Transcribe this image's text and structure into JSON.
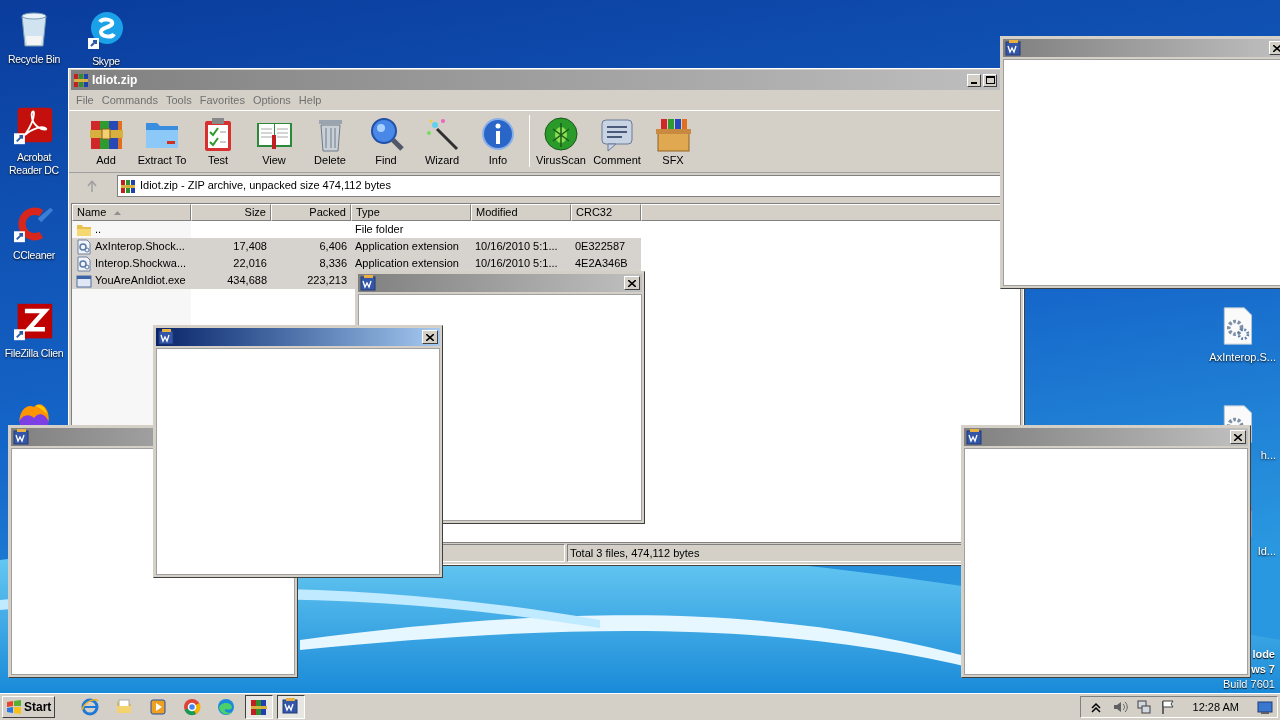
{
  "desktop_icons": [
    {
      "label": "Recycle Bin",
      "kind": "recycle-bin"
    },
    {
      "label": "Skype",
      "kind": "chat"
    },
    {
      "label": "Acrobat Reader DC",
      "kind": "acrobat"
    },
    {
      "label": "CCleaner",
      "kind": "ccleaner"
    },
    {
      "label": "FileZilla Clien",
      "kind": "filezilla"
    },
    {
      "kind": "firefox"
    },
    {
      "label": "AxInterop.S...",
      "kind": "gear-file"
    },
    {
      "label": "h...",
      "kind": "gear-file"
    },
    {
      "label": "Id...",
      "kind": "exe-file"
    }
  ],
  "test_mode_lines": [
    {
      "text": "lode",
      "bold": true
    },
    {
      "text": "ws 7",
      "bold": true
    },
    {
      "text": "Build 7601",
      "bold": false
    }
  ],
  "archive_window": {
    "title": "Idiot.zip",
    "active": false,
    "menu": [
      "File",
      "Commands",
      "Tools",
      "Favorites",
      "Options",
      "Help"
    ],
    "toolbar_groups": [
      [
        {
          "label": "Add",
          "kind": "add"
        },
        {
          "label": "Extract To",
          "kind": "extract"
        },
        {
          "label": "Test",
          "kind": "test"
        },
        {
          "label": "View",
          "kind": "view"
        },
        {
          "label": "Delete",
          "kind": "delete"
        },
        {
          "label": "Find",
          "kind": "find"
        },
        {
          "label": "Wizard",
          "kind": "wizard"
        },
        {
          "label": "Info",
          "kind": "info"
        }
      ],
      [
        {
          "label": "VirusScan",
          "kind": "virusscan"
        },
        {
          "label": "Comment",
          "kind": "comment"
        },
        {
          "label": "SFX",
          "kind": "sfx"
        }
      ]
    ],
    "address": "Idiot.zip - ZIP archive, unpacked size 474,112 bytes",
    "table": {
      "columns": [
        {
          "label": "Name",
          "sorted": true
        },
        {
          "label": "Size",
          "sorted": false
        },
        {
          "label": "Packed",
          "sorted": false
        },
        {
          "label": "Type",
          "sorted": false
        },
        {
          "label": "Modified",
          "sorted": false
        },
        {
          "label": "CRC32",
          "sorted": false
        }
      ],
      "rows": [
        {
          "kind": "folder",
          "selected": false,
          "name": "..",
          "type": "File folder"
        },
        {
          "kind": "dll",
          "selected": true,
          "name": "AxInterop.Shock...",
          "size": "17,408",
          "packed": "6,406",
          "type": "Application extension",
          "modified": "10/16/2010 5:1...",
          "crc32": "0E322587"
        },
        {
          "kind": "dll",
          "selected": true,
          "name": "Interop.Shockwa...",
          "size": "22,016",
          "packed": "8,336",
          "type": "Application extension",
          "modified": "10/16/2010 5:1...",
          "crc32": "4E2A346B"
        },
        {
          "kind": "exe",
          "selected": true,
          "name": "YouAreAnIdiot.exe",
          "size": "434,688",
          "packed": "223,213"
        }
      ]
    },
    "status": "Total 3 files, 474,112 bytes"
  },
  "popup_windows": [
    {
      "active": false
    },
    {
      "active": false
    },
    {
      "active": false
    },
    {
      "active": true
    },
    {
      "active": false
    }
  ],
  "taskbar": {
    "start_label": "Start",
    "apps": [
      {
        "kind": "ie",
        "pressed": false
      },
      {
        "kind": "folder",
        "pressed": false
      },
      {
        "kind": "media",
        "pressed": false
      },
      {
        "kind": "chrome",
        "pressed": false
      },
      {
        "kind": "edge",
        "pressed": false
      },
      {
        "kind": "winrar",
        "pressed": true
      },
      {
        "kind": "word",
        "pressed": true
      }
    ],
    "tray": [
      {
        "kind": "caret"
      },
      {
        "kind": "speaker"
      },
      {
        "kind": "network"
      },
      {
        "kind": "flag"
      }
    ],
    "clock": "12:28 AM"
  }
}
